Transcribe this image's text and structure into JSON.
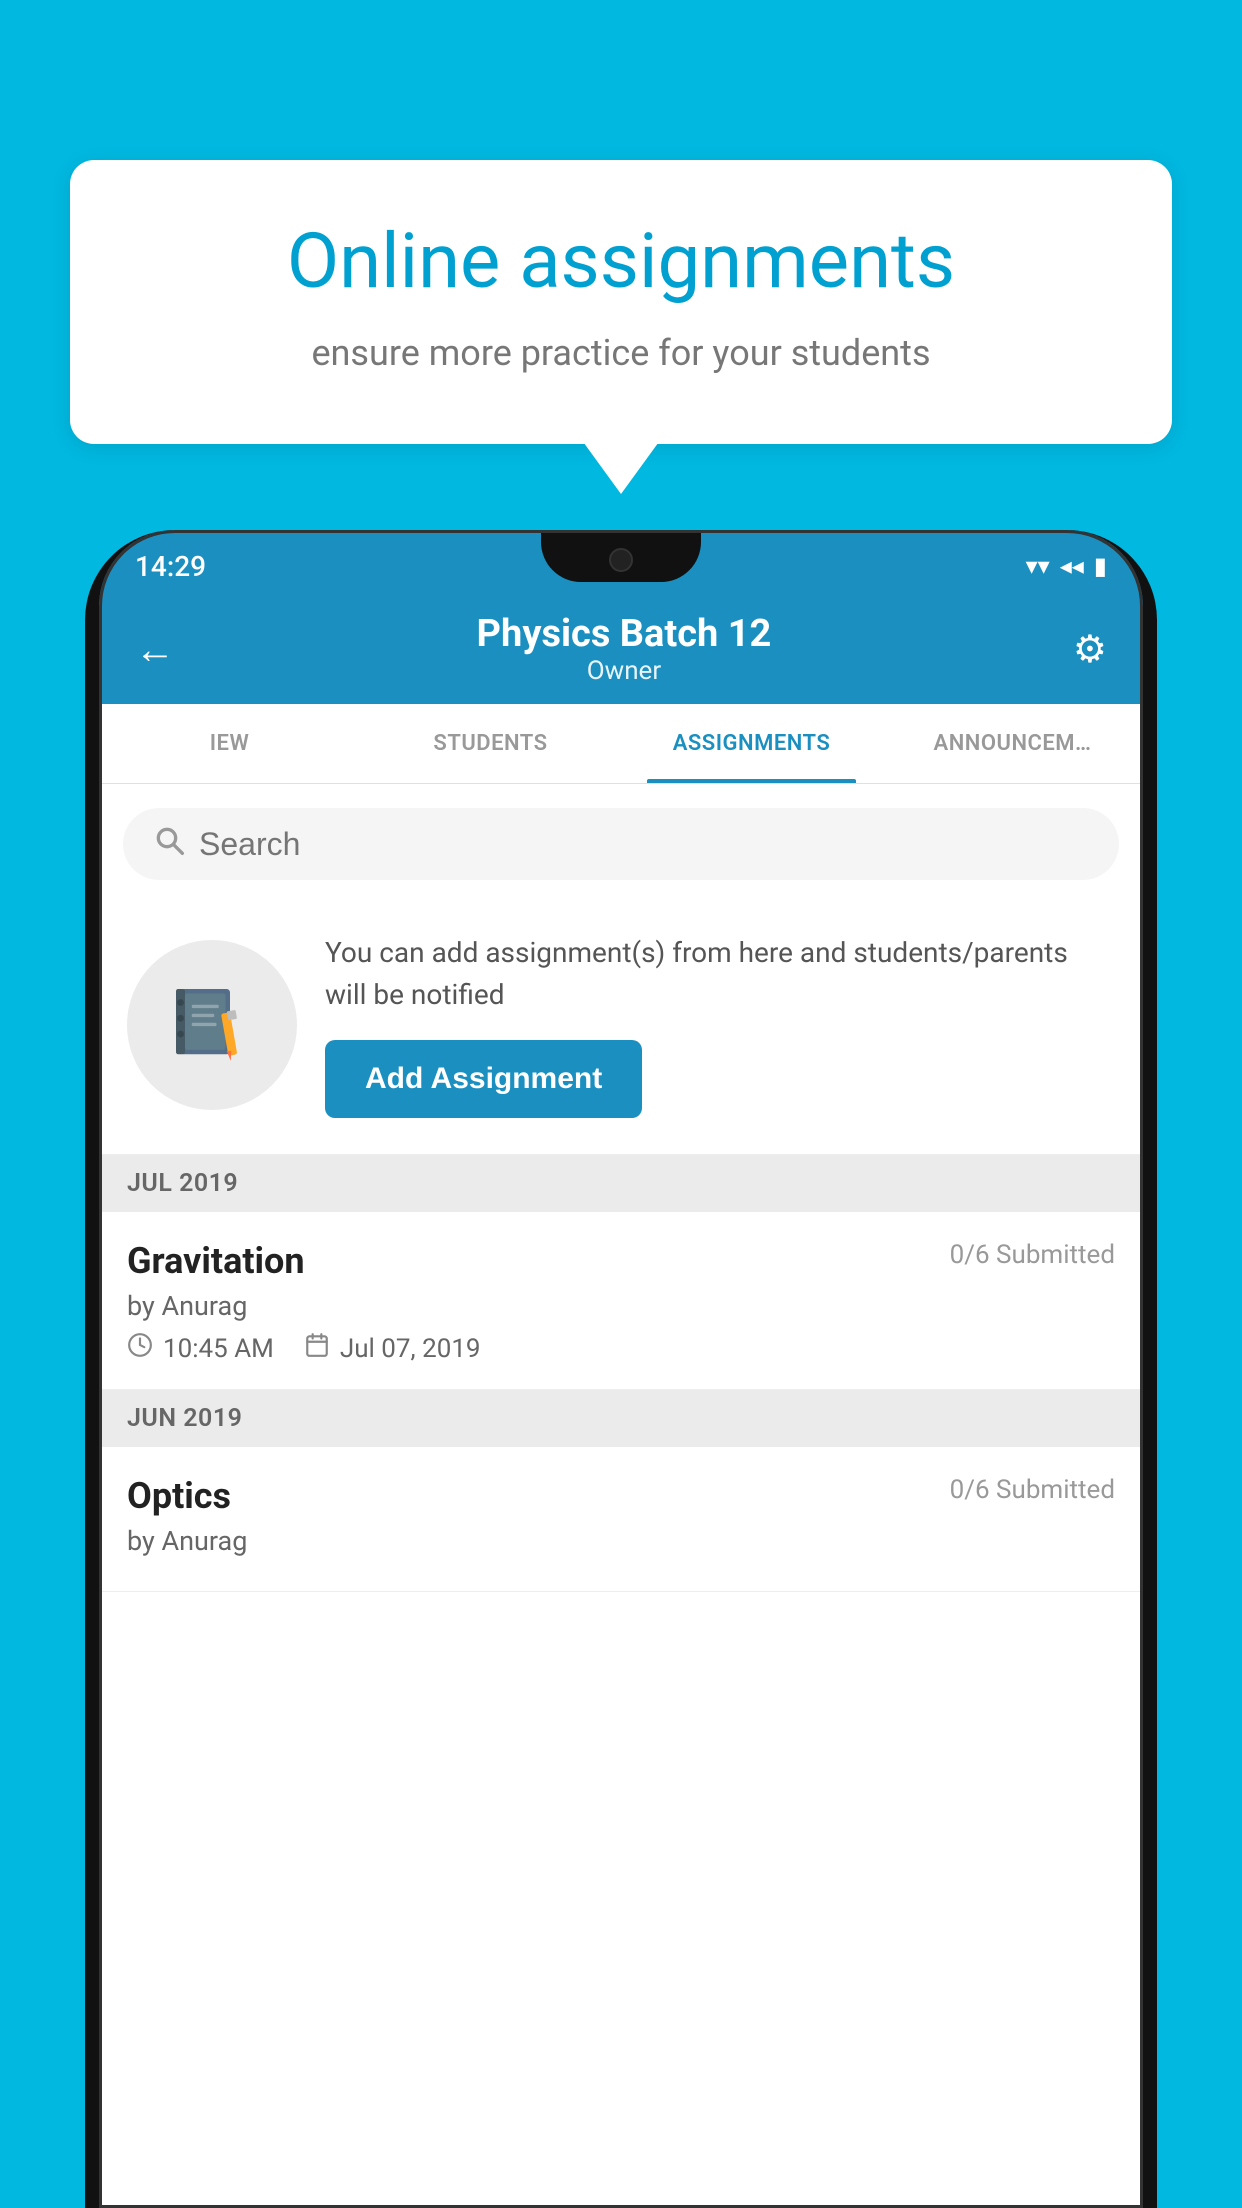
{
  "background_color": "#00B8E0",
  "speech_bubble": {
    "title": "Online assignments",
    "subtitle": "ensure more practice for your students"
  },
  "status_bar": {
    "time": "14:29",
    "wifi": "▼",
    "signal": "▲",
    "battery": "▌"
  },
  "app_header": {
    "title": "Physics Batch 12",
    "subtitle": "Owner",
    "back_label": "←",
    "settings_label": "⚙"
  },
  "tabs": [
    {
      "id": "iew",
      "label": "IEW",
      "active": false
    },
    {
      "id": "students",
      "label": "STUDENTS",
      "active": false
    },
    {
      "id": "assignments",
      "label": "ASSIGNMENTS",
      "active": true
    },
    {
      "id": "announcements",
      "label": "ANNOUNCEMENTS",
      "active": false
    }
  ],
  "search": {
    "placeholder": "Search"
  },
  "add_assignment": {
    "description": "You can add assignment(s) from here and students/parents will be notified",
    "button_label": "Add Assignment"
  },
  "sections": [
    {
      "month": "JUL 2019",
      "assignments": [
        {
          "name": "Gravitation",
          "submitted": "0/6 Submitted",
          "by": "by Anurag",
          "time": "10:45 AM",
          "date": "Jul 07, 2019"
        }
      ]
    },
    {
      "month": "JUN 2019",
      "assignments": [
        {
          "name": "Optics",
          "submitted": "0/6 Submitted",
          "by": "by Anurag",
          "time": "",
          "date": ""
        }
      ]
    }
  ]
}
